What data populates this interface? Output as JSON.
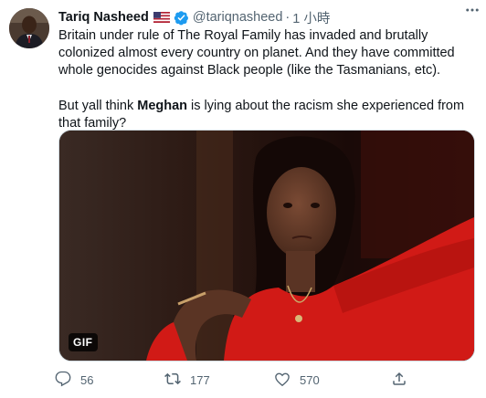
{
  "author": {
    "name": "Tariq Nasheed",
    "handle": "@tariqnasheed",
    "separator": "·",
    "time": "1 小時"
  },
  "tweet": {
    "paragraph1": "Britain under rule of The Royal Family has invaded and brutally colonized almost every country on planet. And they have committed whole genocides against Black people (like the Tasmanians, etc).",
    "paragraph2_before": "But yall think ",
    "paragraph2_bold": "Meghan",
    "paragraph2_after": " is lying about the racism she experienced from that family?"
  },
  "media": {
    "badge": "GIF"
  },
  "actions": {
    "replies": "56",
    "retweets": "177",
    "likes": "570"
  },
  "colors": {
    "text": "#0f1419",
    "muted": "#536471",
    "verified": "#1d9bf0",
    "dress_red": "#d11a16"
  },
  "icons": [
    "flag-us-icon",
    "verified-badge-icon",
    "more-icon",
    "reply-icon",
    "retweet-icon",
    "like-icon",
    "share-icon"
  ]
}
